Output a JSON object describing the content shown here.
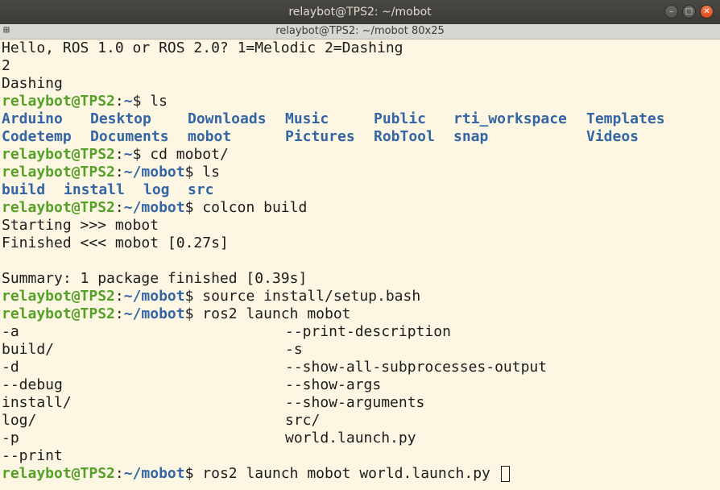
{
  "window": {
    "title": "relaybot@TPS2: ~/mobot"
  },
  "tab": {
    "title": "relaybot@TPS2: ~/mobot 80x25"
  },
  "prompt": {
    "user": "relaybot@TPS2",
    "home_path": ":~",
    "mobot_path": ":~/mobot",
    "sigil": "$"
  },
  "lines": {
    "l1": "Hello, ROS 1.0 or ROS 2.0? 1=Melodic 2=Dashing",
    "l2": "2",
    "l3": "Dashing",
    "cmd1": " ls",
    "cmd2": " cd mobot/",
    "cmd3": " ls",
    "cmd4": " colcon build",
    "out_start": "Starting >>> mobot",
    "out_finish": "Finished <<< mobot [0.27s]",
    "out_summary": "Summary: 1 package finished [0.39s]",
    "cmd5": " source install/setup.bash",
    "cmd6": " ros2 launch mobot",
    "cmd7": " ros2 launch mobot world.launch.py "
  },
  "home_dirs": {
    "row1": [
      "Arduino",
      "Desktop",
      "Downloads",
      "Music",
      "Public",
      "rti_workspace",
      "Templates"
    ],
    "row2": [
      "Codetemp",
      "Documents",
      "mobot",
      "Pictures",
      "RobTool",
      "snap",
      "Videos"
    ]
  },
  "mobot_dirs": [
    "build",
    "install",
    "log",
    "src"
  ],
  "completions": {
    "left": [
      "-a",
      "build/",
      "-d",
      "--debug",
      "install/",
      "log/",
      "-p",
      "--print"
    ],
    "right": [
      "--print-description",
      "-s",
      "--show-all-subprocesses-output",
      "--show-args",
      "--show-arguments",
      "src/",
      "world.launch.py",
      ""
    ]
  },
  "colors": {
    "prompt_green": "#55a128",
    "dir_blue": "#3465a4",
    "dir_dim_blue": "#6d89b5",
    "background": "#fdf6e3"
  }
}
